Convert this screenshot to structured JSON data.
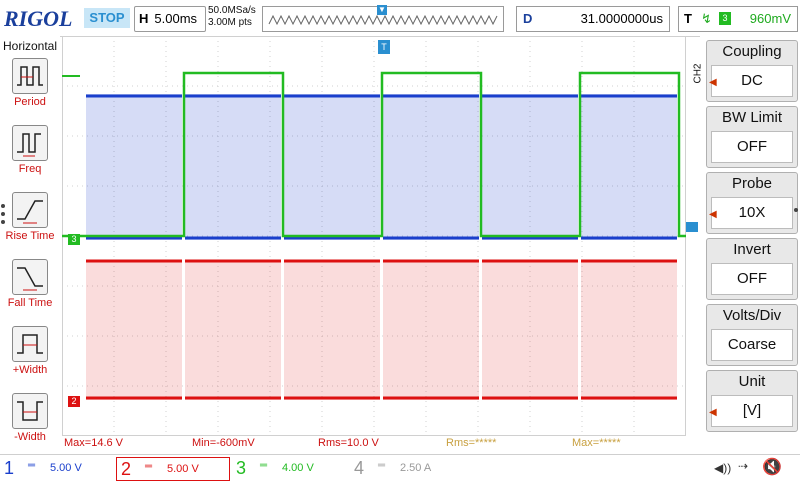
{
  "topbar": {
    "logo": "RIGOL",
    "status": "STOP",
    "timebase_label": "H",
    "timebase_value": "5.00ms",
    "sample_rate": "50.0MSa/s",
    "memory_depth": "3.00M pts",
    "delay_label": "D",
    "delay_value": "31.0000000us",
    "trigger_label": "T",
    "trigger_level": "960mV"
  },
  "left_menu": {
    "title": "Horizontal",
    "items": [
      {
        "label": "Period"
      },
      {
        "label": "Freq"
      },
      {
        "label": "Rise Time"
      },
      {
        "label": "Fall Time"
      },
      {
        "label": "+Width"
      },
      {
        "label": "-Width"
      }
    ]
  },
  "right_menu": {
    "channel_tag": "CH2",
    "items": [
      {
        "heading": "Coupling",
        "value": "DC"
      },
      {
        "heading": "BW Limit",
        "value": "OFF"
      },
      {
        "heading": "Probe",
        "value": "10X"
      },
      {
        "heading": "Invert",
        "value": "OFF"
      },
      {
        "heading": "Volts/Div",
        "value": "Coarse"
      },
      {
        "heading": "Unit",
        "value": "[V]"
      }
    ]
  },
  "measurements": [
    {
      "text": "Max=14.6 V",
      "color": "#cc1111"
    },
    {
      "text": "Min=-600mV",
      "color": "#cc1111"
    },
    {
      "text": "Rms=10.0 V",
      "color": "#cc1111"
    },
    {
      "text": "Rms=*****",
      "color": "#c8a040"
    },
    {
      "text": "Max=*****",
      "color": "#c8a040"
    }
  ],
  "channels": [
    {
      "number": "1",
      "scale": "5.00 V",
      "color": "#1a3fcc"
    },
    {
      "number": "2",
      "scale": "5.00 V",
      "color": "#dd1111"
    },
    {
      "number": "3",
      "scale": "4.00 V",
      "color": "#22bb22"
    },
    {
      "number": "4",
      "scale": "2.50 A",
      "color": "#999999"
    }
  ],
  "markers": {
    "ch2_marker": "2",
    "ch3_marker": "3",
    "trigger_marker": "T"
  },
  "colors": {
    "ch1": "#1a3fcc",
    "ch2": "#dd1111",
    "ch3": "#22bb22",
    "grid": "#d0d0d0",
    "accent": "#1a3f9c"
  }
}
